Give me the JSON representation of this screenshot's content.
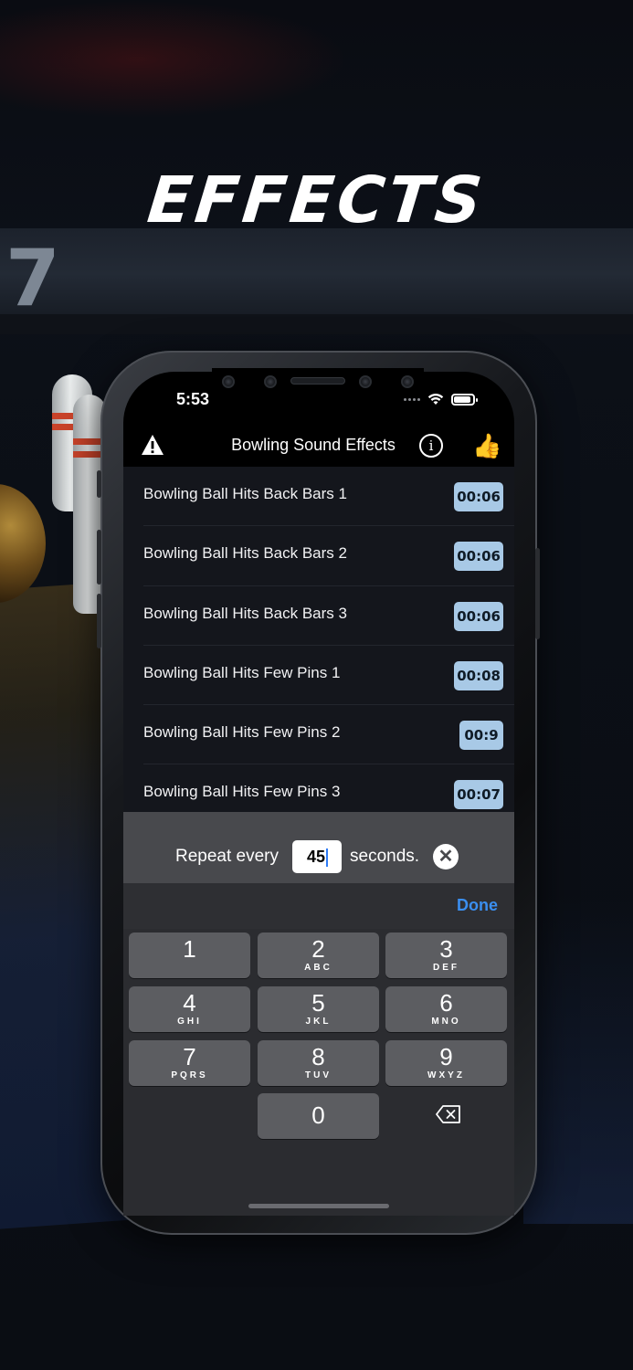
{
  "headline": "EFFECTS",
  "status": {
    "time": "5:53"
  },
  "navbar": {
    "title": "Bowling Sound Effects",
    "left_icon": "warning-icon",
    "info_icon": "info-icon",
    "info_glyph": "i",
    "right_icon": "thumbs-up-icon",
    "right_glyph": "👍"
  },
  "sounds": [
    {
      "title": "Bowling Ball Hits Back Bars 1",
      "duration": "00:06"
    },
    {
      "title": "Bowling Ball Hits Back Bars 2",
      "duration": "00:06"
    },
    {
      "title": "Bowling Ball Hits Back Bars 3",
      "duration": "00:06"
    },
    {
      "title": "Bowling Ball Hits Few Pins 1",
      "duration": "00:08"
    },
    {
      "title": "Bowling Ball Hits Few Pins 2",
      "duration": "00:9"
    },
    {
      "title": "Bowling Ball Hits Few Pins 3",
      "duration": "00:07"
    }
  ],
  "repeat": {
    "label": "Repeat every",
    "value": "45",
    "suffix": "seconds.",
    "clear_glyph": "✕"
  },
  "keyboard": {
    "done_label": "Done",
    "keys": [
      {
        "digit": "1",
        "letters": ""
      },
      {
        "digit": "2",
        "letters": "ABC"
      },
      {
        "digit": "3",
        "letters": "DEF"
      },
      {
        "digit": "4",
        "letters": "GHI"
      },
      {
        "digit": "5",
        "letters": "JKL"
      },
      {
        "digit": "6",
        "letters": "MNO"
      },
      {
        "digit": "7",
        "letters": "PQRS"
      },
      {
        "digit": "8",
        "letters": "TUV"
      },
      {
        "digit": "9",
        "letters": "WXYZ"
      },
      {
        "digit": "0",
        "letters": ""
      }
    ]
  },
  "background": {
    "lane_number": "7"
  },
  "colors": {
    "duration_badge": "#a8c9e6",
    "done_blue": "#3b8ff0",
    "list_bg": "#14161c"
  }
}
